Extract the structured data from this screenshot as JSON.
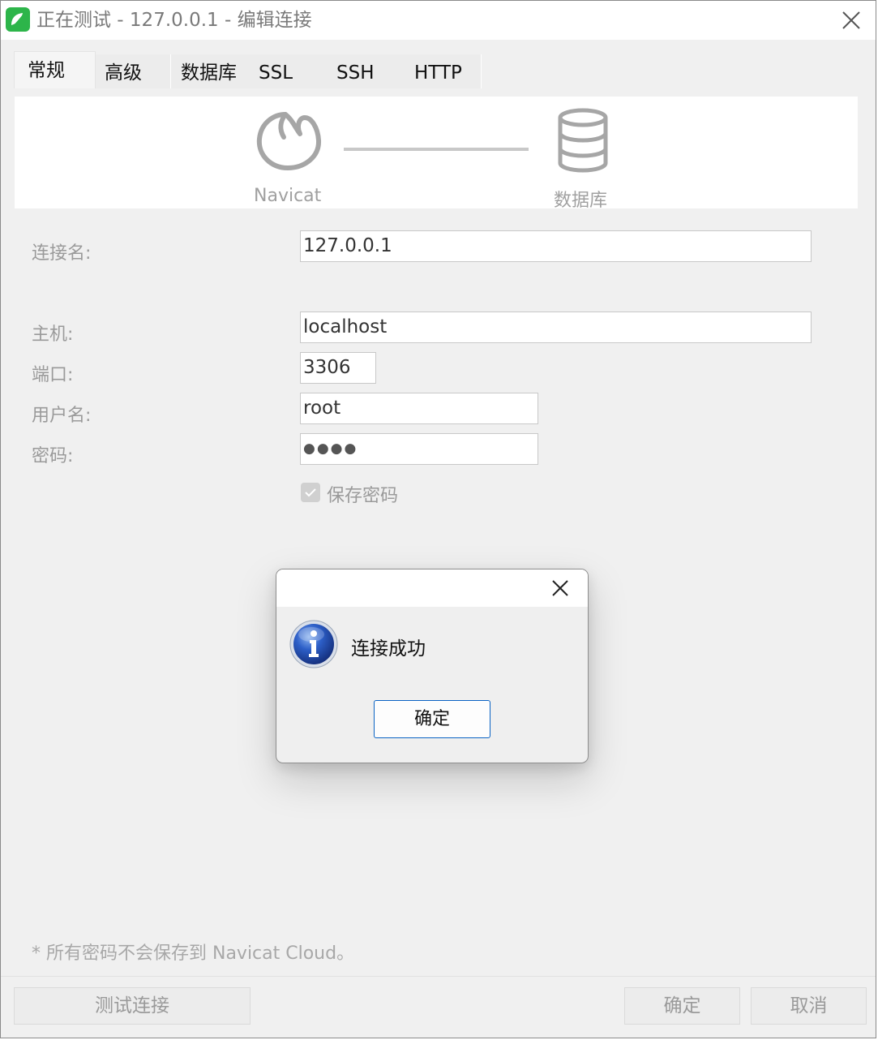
{
  "window": {
    "title": "正在测试 - 127.0.0.1 - 编辑连接",
    "app_icon": "navicat-leaf-icon",
    "close_icon": "close-icon",
    "brand_color": "#2db54a"
  },
  "tabs": [
    {
      "label": "常规",
      "active": true
    },
    {
      "label": "高级",
      "active": false
    },
    {
      "label": "数据库",
      "active": false
    },
    {
      "label": "SSL",
      "active": false
    },
    {
      "label": "SSH",
      "active": false
    },
    {
      "label": "HTTP",
      "active": false
    }
  ],
  "banner": {
    "left_label": "Navicat",
    "right_label": "数据库",
    "left_icon": "navicat-icon",
    "right_icon": "database-icon"
  },
  "form": {
    "connection_name_label": "连接名:",
    "connection_name_value": "127.0.0.1",
    "host_label": "主机:",
    "host_value": "localhost",
    "port_label": "端口:",
    "port_value": "3306",
    "username_label": "用户名:",
    "username_value": "root",
    "password_label": "密码:",
    "password_value": "●●●●",
    "save_password_label": "保存密码",
    "save_password_checked": true
  },
  "footnote": "* 所有密码不会保存到 Navicat Cloud。",
  "buttons": {
    "test": "测试连接",
    "ok": "确定",
    "cancel": "取消"
  },
  "dialog": {
    "message": "连接成功",
    "ok_label": "确定",
    "icon": "info-icon",
    "close_icon": "close-icon",
    "accent_color": "#0a63c4"
  }
}
